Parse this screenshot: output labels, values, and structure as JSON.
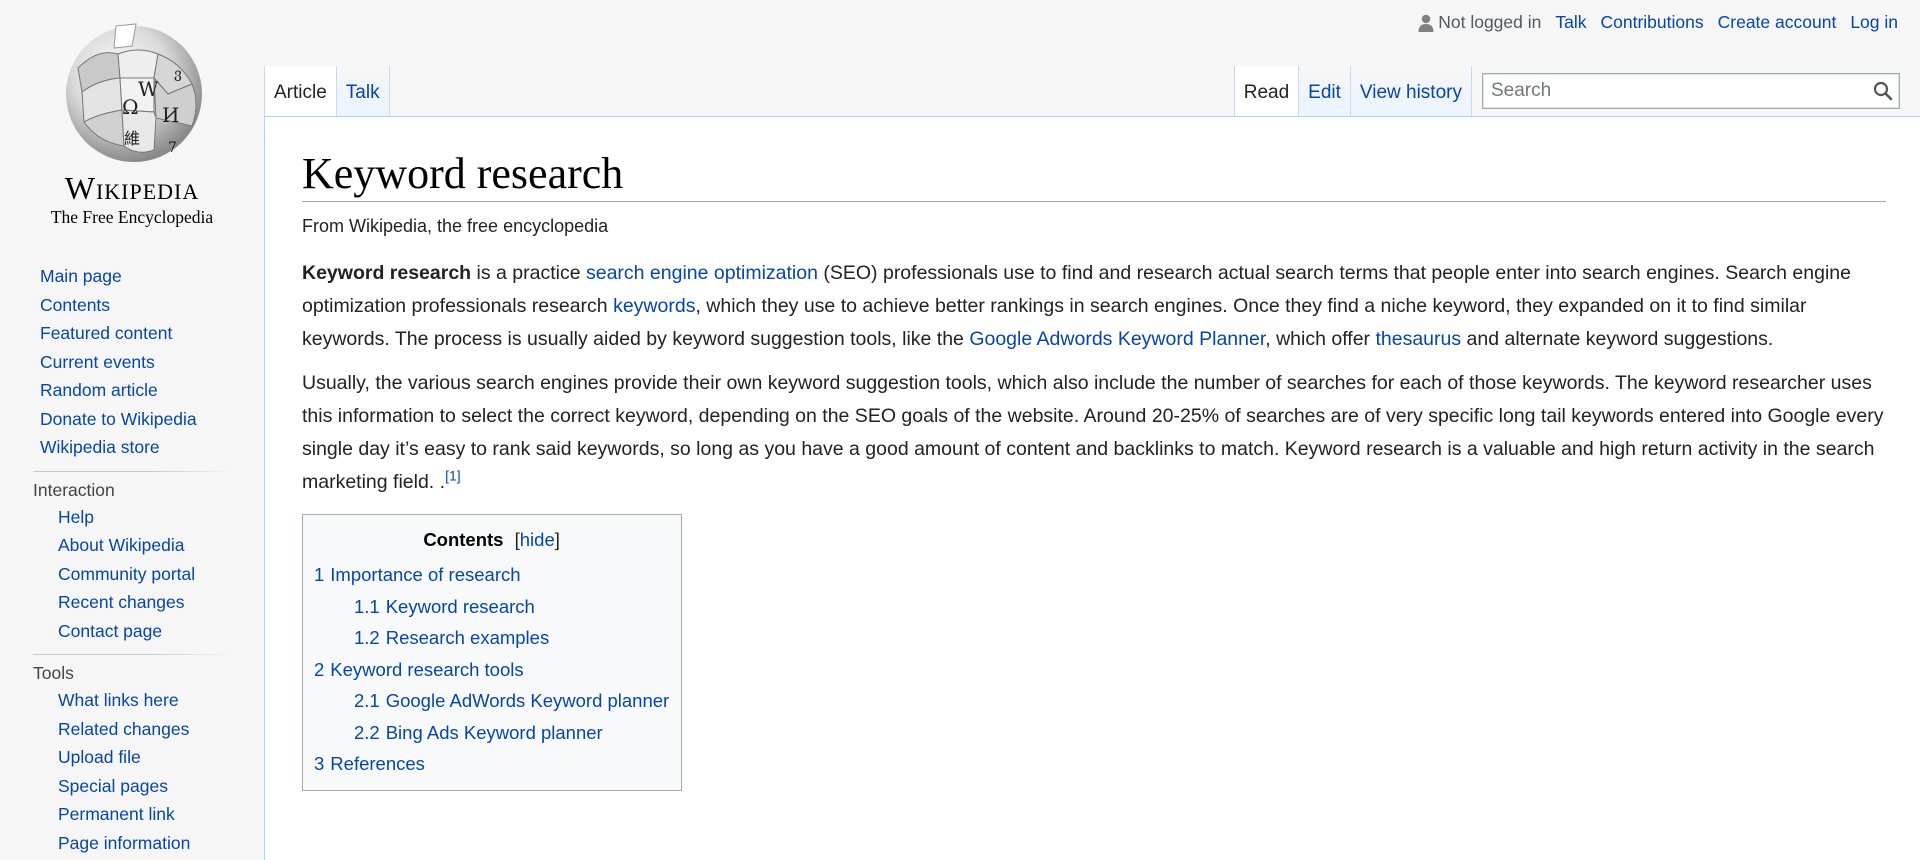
{
  "logo": {
    "wordmark": "Wikipedia",
    "tagline": "The Free Encyclopedia"
  },
  "personal": {
    "not_logged_in": "Not logged in",
    "talk": "Talk",
    "contributions": "Contributions",
    "create_account": "Create account",
    "log_in": "Log in"
  },
  "tabs": {
    "article": "Article",
    "talk": "Talk",
    "read": "Read",
    "edit": "Edit",
    "view_history": "View history"
  },
  "search": {
    "placeholder": "Search"
  },
  "sidebar": {
    "navigation": [
      "Main page",
      "Contents",
      "Featured content",
      "Current events",
      "Random article",
      "Donate to Wikipedia",
      "Wikipedia store"
    ],
    "interaction": {
      "heading": "Interaction",
      "items": [
        "Help",
        "About Wikipedia",
        "Community portal",
        "Recent changes",
        "Contact page"
      ]
    },
    "tools": {
      "heading": "Tools",
      "items": [
        "What links here",
        "Related changes",
        "Upload file",
        "Special pages",
        "Permanent link",
        "Page information"
      ]
    }
  },
  "article": {
    "title": "Keyword research",
    "site_sub": "From Wikipedia, the free encyclopedia",
    "p1": {
      "bold": "Keyword research",
      "t1": " is a practice ",
      "link1": "search engine optimization",
      "t2": " (SEO) professionals use to find and research actual search terms that people enter into search engines. Search engine optimization professionals research ",
      "link2": "keywords",
      "t3": ", which they use to achieve better rankings in search engines. Once they find a niche keyword, they expanded on it to find similar keywords. The process is usually aided by keyword suggestion tools, like the ",
      "link3": "Google Adwords Keyword Planner",
      "t4": ", which offer ",
      "link4": "thesaurus",
      "t5": " and alternate keyword suggestions."
    },
    "p2": {
      "text": "Usually, the various search engines provide their own keyword suggestion tools, which also include the number of searches for each of those keywords. The keyword researcher uses this information to select the correct keyword, depending on the SEO goals of the website. Around 20-25% of searches are of very specific long tail keywords entered into Google every single day it’s easy to rank said keywords, so long as you have a good amount of content and backlinks to match. Keyword research is a valuable and high return activity in the search marketing field. .",
      "ref": "[1]"
    }
  },
  "toc": {
    "title": "Contents",
    "bracket_open": "[",
    "hide": "hide",
    "bracket_close": "]",
    "items": [
      {
        "num": "1",
        "text": "Importance of research"
      },
      {
        "num": "1.1",
        "text": "Keyword research"
      },
      {
        "num": "1.2",
        "text": "Research examples"
      },
      {
        "num": "2",
        "text": "Keyword research tools"
      },
      {
        "num": "2.1",
        "text": "Google AdWords Keyword planner"
      },
      {
        "num": "2.2",
        "text": "Bing Ads Keyword planner"
      },
      {
        "num": "3",
        "text": "References"
      }
    ]
  }
}
